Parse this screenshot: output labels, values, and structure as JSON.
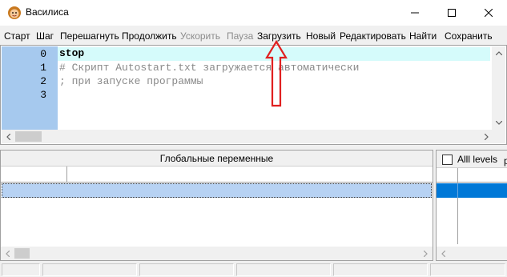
{
  "window": {
    "title": "Василиса"
  },
  "menu": [
    {
      "label": "Старт",
      "enabled": true
    },
    {
      "label": "Шаг",
      "enabled": true
    },
    {
      "label": "Перешагнуть",
      "enabled": true
    },
    {
      "label": "Продолжить",
      "enabled": true
    },
    {
      "label": "Ускорить",
      "enabled": false
    },
    {
      "label": "Пауза",
      "enabled": false
    },
    {
      "label": "Загрузить",
      "enabled": true
    },
    {
      "label": "Новый",
      "enabled": true
    },
    {
      "label": "Редактировать",
      "enabled": true
    },
    {
      "label": "Найти",
      "enabled": true
    },
    {
      "label": "Сохранить",
      "enabled": true
    }
  ],
  "editor": {
    "line_numbers": [
      "0",
      "1",
      "2",
      "3"
    ],
    "lines": [
      {
        "text": "stop",
        "kind": "keyword"
      },
      {
        "text": "# Скрипт Autostart.txt загружается автоматически",
        "kind": "comment"
      },
      {
        "text": "; при запуске программы",
        "kind": "comment"
      },
      {
        "text": "",
        "kind": "plain"
      }
    ]
  },
  "variables_panel": {
    "header": "Глобальные переменные"
  },
  "levels_panel": {
    "checkbox_label": "Alll levels",
    "extra_label": "p"
  },
  "colors": {
    "gutter": "#a6c9ee",
    "current_line": "#d5fbfb",
    "selected_row": "#b7d2f3",
    "levels_selected": "#0078d7",
    "annotation_arrow": "#e02020"
  },
  "icons": {
    "app": "vasilisa-face-icon",
    "minimize": "minimize-icon",
    "maximize": "maximize-icon",
    "close": "close-icon"
  }
}
